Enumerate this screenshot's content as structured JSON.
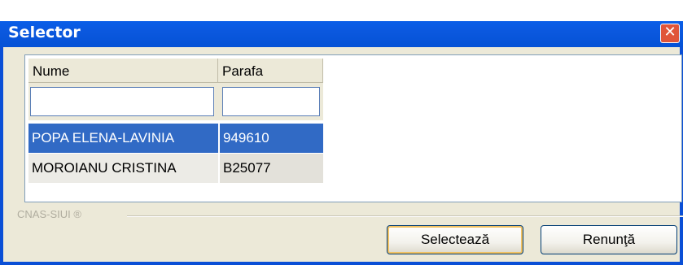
{
  "window": {
    "title": "Selector",
    "close_glyph": "✕"
  },
  "grid": {
    "columns": [
      "Nume",
      "Parafa"
    ],
    "filters": {
      "nume": "",
      "parafa": ""
    },
    "rows": [
      {
        "nume": "POPA ELENA-LAVINIA",
        "parafa": "949610",
        "selected": true
      },
      {
        "nume": "MOROIANU CRISTINA",
        "parafa": "B25077",
        "selected": false
      }
    ]
  },
  "footer": {
    "brand": "CNAS-SIUI ®"
  },
  "buttons": {
    "select": "Selectează",
    "cancel": "Renunţă"
  },
  "colors": {
    "titlebar": "#0a5ee8",
    "selection": "#316ac5",
    "face": "#ece9d8"
  }
}
